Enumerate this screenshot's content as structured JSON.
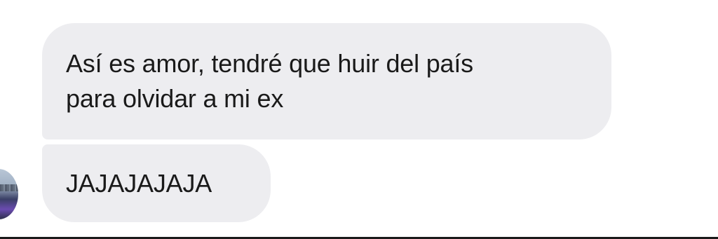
{
  "conversation": {
    "messages": [
      {
        "text": "Así es amor, tendré que huir del país\npara olvidar a mi ex"
      },
      {
        "text": "JAJAJAJAJA"
      }
    ],
    "avatar": {
      "icon": "profile-photo-avatar"
    }
  },
  "colors": {
    "bubble_background": "#ededf0",
    "text": "#1a1a1a",
    "page_background": "#ffffff"
  }
}
